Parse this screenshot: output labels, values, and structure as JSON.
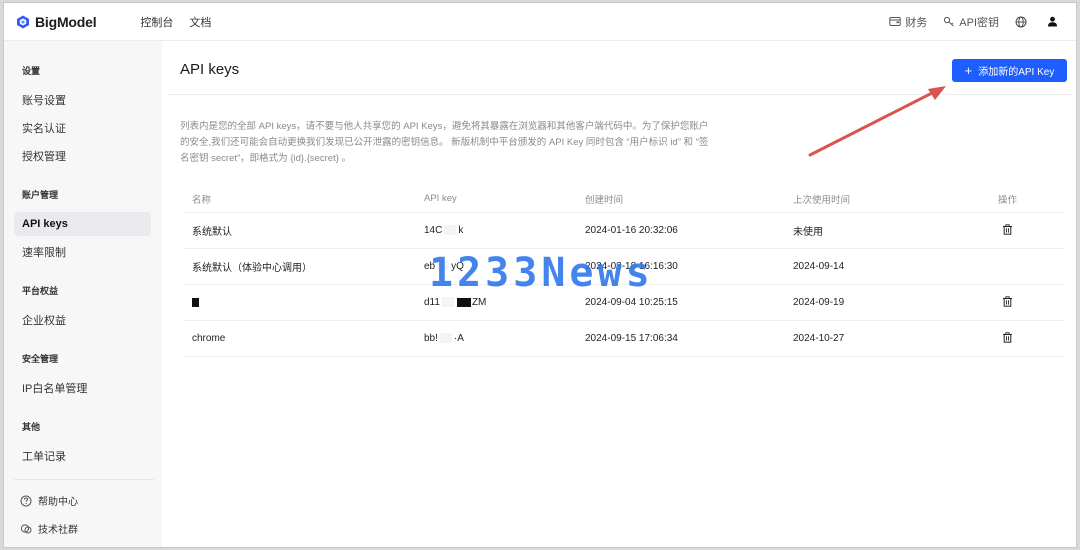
{
  "topbar": {
    "brand": "BigModel",
    "nav": [
      "控制台",
      "文档"
    ],
    "finance_label": "财务",
    "api_key_label": "API密钥"
  },
  "sidebar": {
    "sections": [
      {
        "title": "设置",
        "items": [
          "账号设置",
          "实名认证",
          "授权管理"
        ]
      },
      {
        "title": "账户管理",
        "items": [
          "API keys",
          "速率限制"
        ]
      },
      {
        "title": "平台权益",
        "items": [
          "企业权益"
        ]
      },
      {
        "title": "安全管理",
        "items": [
          "IP白名单管理"
        ]
      },
      {
        "title": "其他",
        "items": [
          "工单记录"
        ]
      }
    ],
    "footer": [
      "帮助中心",
      "技术社群"
    ],
    "active": "API keys"
  },
  "main": {
    "title": "API keys",
    "add_button": "添加新的API Key",
    "description": "列表内是您的全部 API keys，请不要与他人共享您的 API Keys，避免将其暴露在浏览器和其他客户端代码中。为了保护您账户的安全,我们还可能会自动更换我们发现已公开泄露的密钥信息。 新版机制中平台颁发的 API Key 同时包含 “用户标识 id” 和 “签名密钥 secret”，即格式为 {id}.{secret} 。",
    "columns": [
      "名称",
      "API key",
      "创建时间",
      "上次使用时间",
      "操作"
    ],
    "rows": [
      {
        "name": "系统默认",
        "key_prefix": "14C",
        "key_suffix": "k",
        "created": "2024-01-16 20:32:06",
        "last_used": "未使用",
        "deletable": true
      },
      {
        "name": "系统默认（体验中心调用）",
        "key_prefix": "eb",
        "key_suffix": "yQ",
        "created": "2024-03-18 16:16:30",
        "last_used": "2024-09-14",
        "deletable": false
      },
      {
        "name": "",
        "key_prefix": "d11",
        "key_suffix": "ZM",
        "created": "2024-09-04 10:25:15",
        "last_used": "2024-09-19",
        "deletable": true
      },
      {
        "name": "chrome",
        "key_prefix": "bb!",
        "key_suffix": "·A",
        "created": "2024-09-15 17:06:34",
        "last_used": "2024-10-27",
        "deletable": true
      }
    ]
  },
  "watermark": "1233News",
  "colors": {
    "accent": "#1e5eff",
    "arrow": "#d9534f",
    "watermark": "#2f78ea"
  },
  "icons": [
    "logo-icon",
    "wallet-icon",
    "key-icon",
    "globe-icon",
    "user-icon",
    "trash-icon",
    "help-icon",
    "community-icon",
    "plus-icon"
  ]
}
